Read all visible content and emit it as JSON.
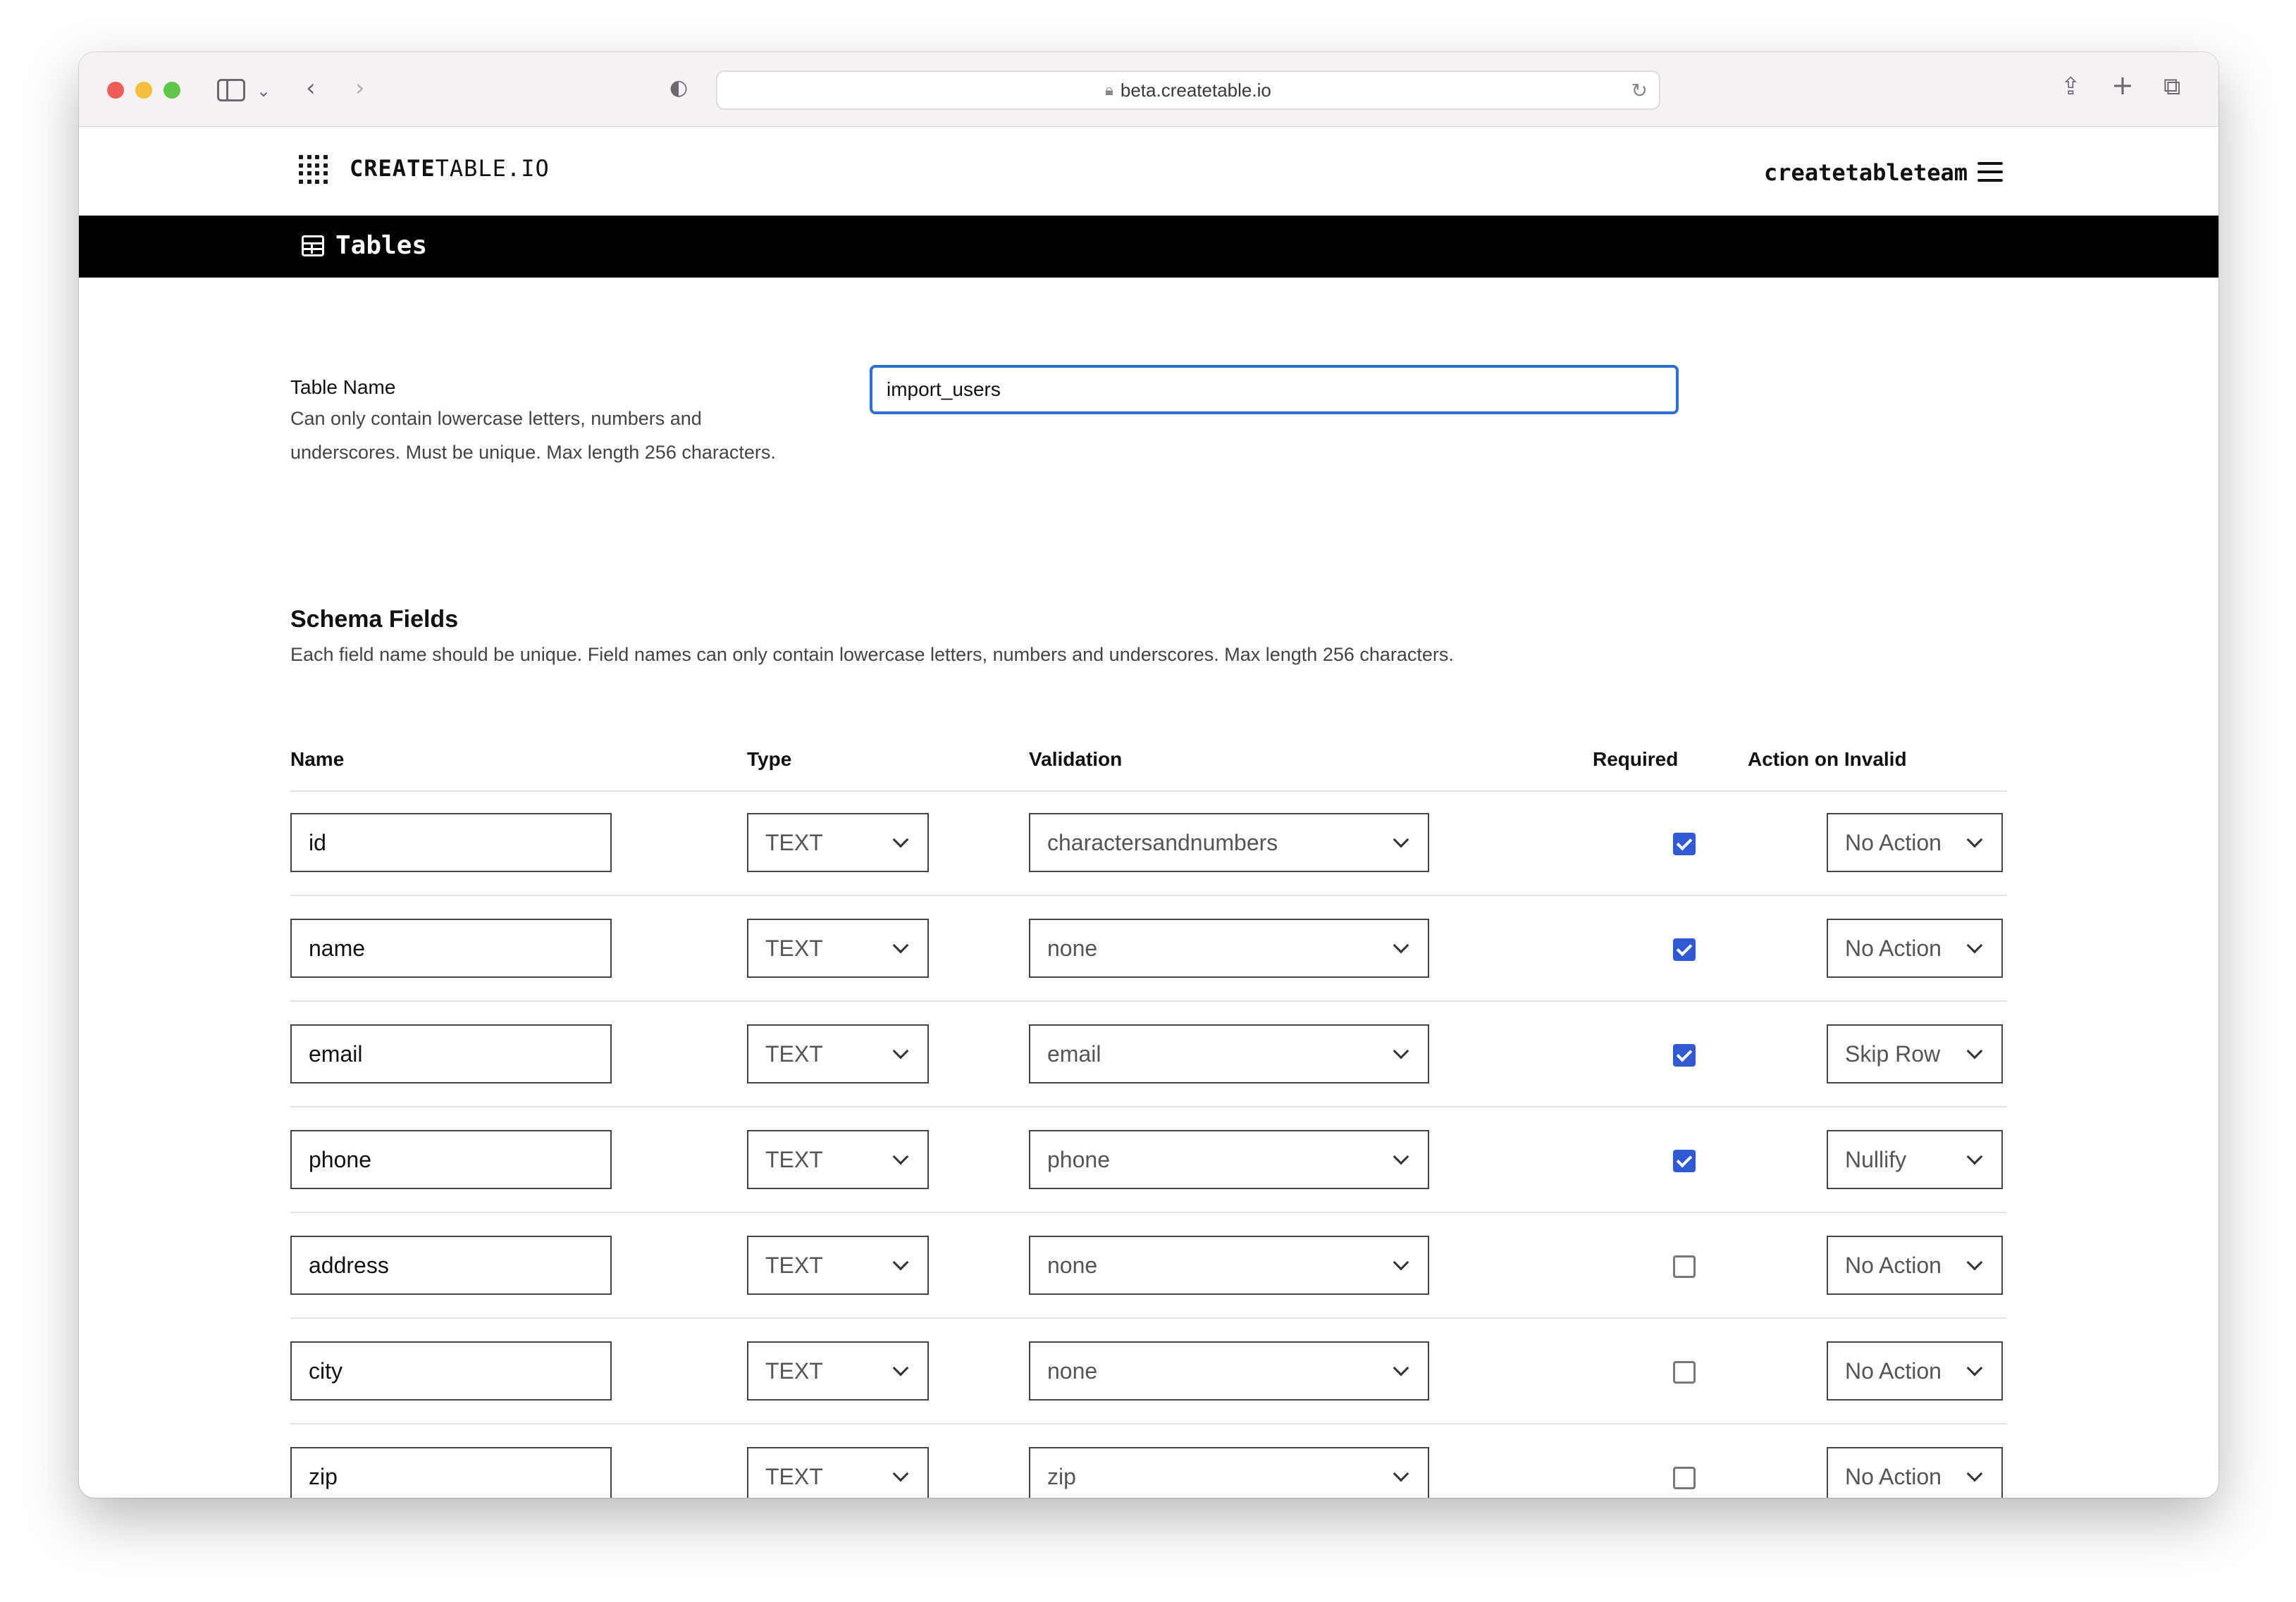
{
  "browser": {
    "url": "beta.createtable.io"
  },
  "header": {
    "brand_bold": "CREATE",
    "brand_rest": "TABLE.IO",
    "team": "createtableteam"
  },
  "nav": {
    "title": "Tables"
  },
  "table_name": {
    "label": "Table Name",
    "help_line1": "Can only contain lowercase letters, numbers and",
    "help_line2": "underscores. Must be unique. Max length 256 characters.",
    "value": "import_users"
  },
  "schema": {
    "title": "Schema Fields",
    "help": "Each field name should be unique. Field names can only contain lowercase letters, numbers and underscores. Max length 256 characters.",
    "columns": {
      "name": "Name",
      "type": "Type",
      "validation": "Validation",
      "required": "Required",
      "action": "Action on Invalid"
    },
    "rows": [
      {
        "name": "id",
        "type": "TEXT",
        "validation": "charactersandnumbers",
        "required": true,
        "action": "No Action"
      },
      {
        "name": "name",
        "type": "TEXT",
        "validation": "none",
        "required": true,
        "action": "No Action"
      },
      {
        "name": "email",
        "type": "TEXT",
        "validation": "email",
        "required": true,
        "action": "Skip Row"
      },
      {
        "name": "phone",
        "type": "TEXT",
        "validation": "phone",
        "required": true,
        "action": "Nullify"
      },
      {
        "name": "address",
        "type": "TEXT",
        "validation": "none",
        "required": false,
        "action": "No Action"
      },
      {
        "name": "city",
        "type": "TEXT",
        "validation": "none",
        "required": false,
        "action": "No Action"
      },
      {
        "name": "zip",
        "type": "TEXT",
        "validation": "zip",
        "required": false,
        "action": "No Action"
      }
    ]
  },
  "colors": {
    "focus": "#2e6fd6",
    "checkbox": "#2f5ad4",
    "navbar": "#000000"
  }
}
